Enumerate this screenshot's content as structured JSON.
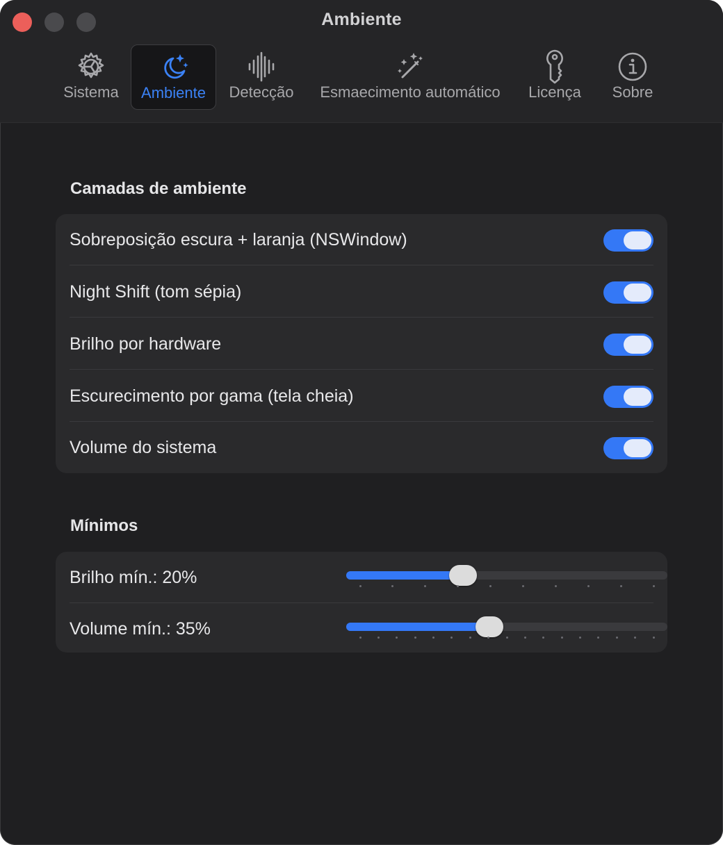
{
  "window": {
    "title": "Ambiente"
  },
  "tabs": [
    {
      "label": "Sistema",
      "icon": "gear-icon",
      "active": false
    },
    {
      "label": "Ambiente",
      "icon": "moon-stars-icon",
      "active": true
    },
    {
      "label": "Detecção",
      "icon": "waveform-icon",
      "active": false
    },
    {
      "label": "Esmaecimento automático",
      "icon": "magic-wand-icon",
      "active": false
    },
    {
      "label": "Licença",
      "icon": "key-icon",
      "active": false
    },
    {
      "label": "Sobre",
      "icon": "info-icon",
      "active": false
    }
  ],
  "layers": {
    "title": "Camadas de ambiente",
    "items": [
      {
        "label": "Sobreposição escura + laranja (NSWindow)",
        "on": true
      },
      {
        "label": "Night Shift (tom sépia)",
        "on": true
      },
      {
        "label": "Brilho por hardware",
        "on": true
      },
      {
        "label": "Escurecimento por gama (tela cheia)",
        "on": true
      },
      {
        "label": "Volume do sistema",
        "on": true
      }
    ]
  },
  "minimums": {
    "title": "Mínimos",
    "items": [
      {
        "label": "Brilho mín.: 20%",
        "value": 0.35,
        "ticks": 10
      },
      {
        "label": "Volume mín.: 35%",
        "value": 0.44,
        "ticks": 17
      }
    ]
  },
  "colors": {
    "accent": "#3478f6",
    "background": "#1f1f21",
    "card": "#2a2a2c",
    "close": "#ec5f5a"
  }
}
